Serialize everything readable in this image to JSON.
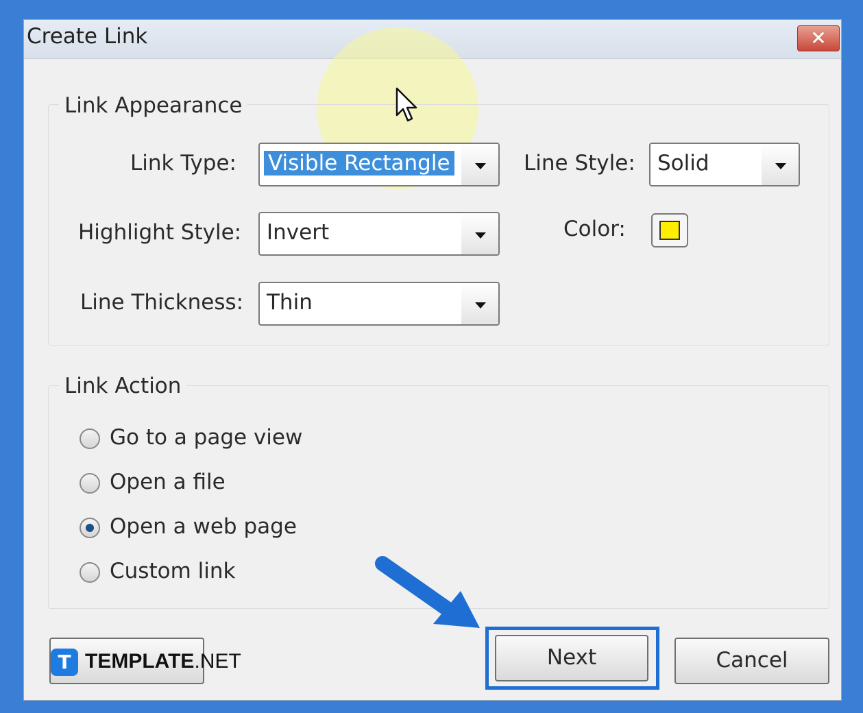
{
  "window": {
    "title": "Create Link",
    "close_glyph": "✕"
  },
  "link_appearance": {
    "legend": "Link Appearance",
    "link_type_label": "Link Type:",
    "link_type_value": "Visible Rectangle",
    "line_style_label": "Line Style:",
    "line_style_value": "Solid",
    "highlight_style_label": "Highlight Style:",
    "highlight_style_value": "Invert",
    "color_label": "Color:",
    "color_value": "#ffee00",
    "line_thickness_label": "Line Thickness:",
    "line_thickness_value": "Thin"
  },
  "link_action": {
    "legend": "Link Action",
    "options": [
      {
        "label": "Go to a page view",
        "checked": false
      },
      {
        "label": "Open a file",
        "checked": false
      },
      {
        "label": "Open a web page",
        "checked": true
      },
      {
        "label": "Custom link",
        "checked": false
      }
    ]
  },
  "buttons": {
    "next_label": "Next",
    "cancel_label": "Cancel"
  },
  "watermark": {
    "logo_letter": "T",
    "brand_bold": "TEMPLATE",
    "brand_suffix": ".NET"
  },
  "colors": {
    "accent": "#1e6ed3",
    "selection": "#3e8fdb",
    "background": "#3a7fd5"
  },
  "icons": {
    "cursor": "mouse-pointer-icon",
    "arrow": "pointer-arrow-icon",
    "dropdown": "chevron-down-icon"
  }
}
